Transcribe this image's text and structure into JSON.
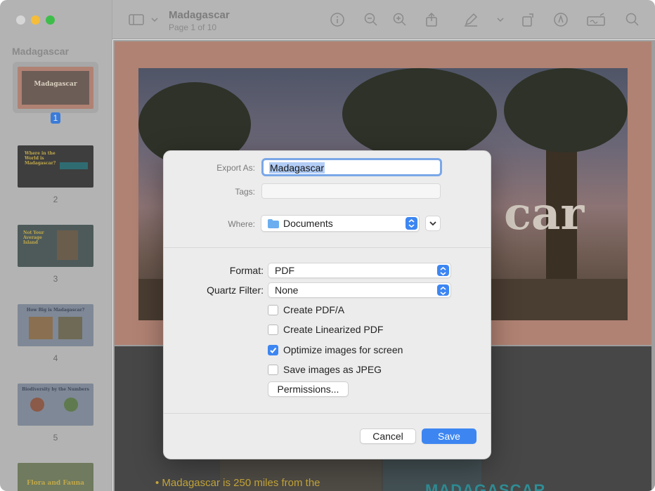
{
  "toolbar": {
    "doc_title": "Madagascar",
    "doc_subtitle": "Page 1 of 10",
    "icons": [
      "sidebar-toggle-icon",
      "chevron-down-icon",
      "info-icon",
      "zoom-out-icon",
      "zoom-in-icon",
      "share-icon",
      "markup-pen-icon",
      "chevron-down-icon",
      "rotate-icon",
      "annotate-icon",
      "signature-icon",
      "search-icon"
    ]
  },
  "sidebar": {
    "title": "Madagascar",
    "thumbnails": [
      {
        "page": "1",
        "label": "Madagascar",
        "bg": "#b08273",
        "selected": true
      },
      {
        "page": "2",
        "label": "Where in the World is Madagascar?",
        "bg": "#3e3e3e",
        "selected": false
      },
      {
        "page": "3",
        "label": "Not Your Average Island",
        "bg": "#4e5a5a",
        "selected": false
      },
      {
        "page": "4",
        "label": "How Big is Madagascar?",
        "bg": "#7f8896",
        "selected": false
      },
      {
        "page": "5",
        "label": "Biodiversity by the Numbers",
        "bg": "#7f8896",
        "selected": false
      },
      {
        "page": "",
        "label": "Flora and Fauna",
        "bg": "#6f7a5e",
        "selected": false
      }
    ]
  },
  "document": {
    "page1_title_fragment": "car",
    "page2_bullet": "• Madagascar is 250 miles from the",
    "page2_logo": "MADAGASCAR"
  },
  "dialog": {
    "export_as_label": "Export As:",
    "export_as_value": "Madagascar",
    "tags_label": "Tags:",
    "where_label": "Where:",
    "where_value": "Documents",
    "format_label": "Format:",
    "format_value": "PDF",
    "quartz_label": "Quartz Filter:",
    "quartz_value": "None",
    "options": [
      {
        "label": "Create PDF/A",
        "checked": false
      },
      {
        "label": "Create Linearized PDF",
        "checked": false
      },
      {
        "label": "Optimize images for screen",
        "checked": true
      },
      {
        "label": "Save images as JPEG",
        "checked": false
      }
    ],
    "permissions_label": "Permissions...",
    "cancel_label": "Cancel",
    "save_label": "Save"
  },
  "colors": {
    "accent": "#3d86f2",
    "dim_overlay": "#b5b5b5"
  }
}
